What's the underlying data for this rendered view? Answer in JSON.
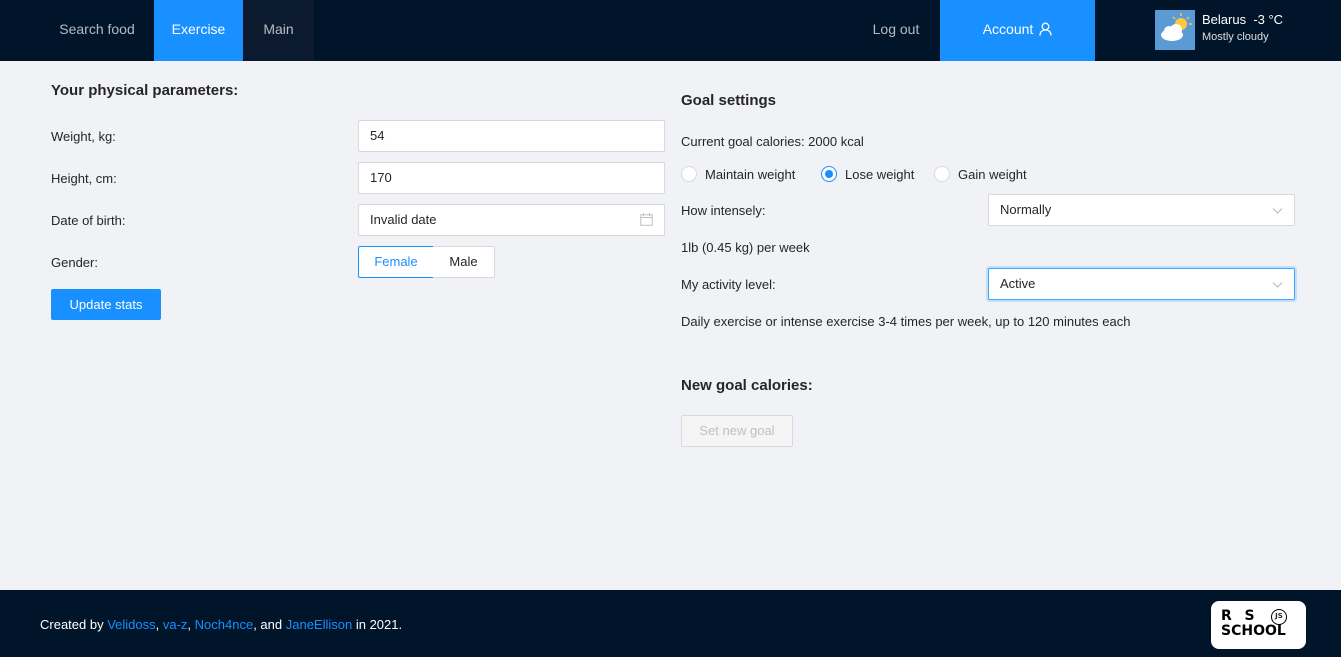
{
  "header": {
    "nav": {
      "search_food": "Search food",
      "exercise": "Exercise",
      "main": "Main",
      "logout": "Log out",
      "account": "Account"
    },
    "weather": {
      "location": "Belarus",
      "temperature": "-3 °C",
      "description": "Mostly cloudy",
      "icon": "partly-cloudy-icon"
    }
  },
  "physical": {
    "title": "Your physical parameters:",
    "weight_label": "Weight, kg:",
    "weight_value": "54",
    "height_label": "Height, cm:",
    "height_value": "170",
    "dob_label": "Date of birth:",
    "dob_value": "Invalid date",
    "gender_label": "Gender:",
    "gender_options": [
      "Female",
      "Male"
    ],
    "gender_selected": "Female",
    "update_button": "Update stats"
  },
  "goal": {
    "title": "Goal settings",
    "current_calories": "Current goal calories: 2000 kcal",
    "goal_options": [
      "Maintain weight",
      "Lose weight",
      "Gain weight"
    ],
    "goal_selected": "Lose weight",
    "intensity_label": "How intensely:",
    "intensity_value": "Normally",
    "intensity_note": "1lb (0.45 kg) per week",
    "activity_label": "My activity level:",
    "activity_value": "Active",
    "activity_note": "Daily exercise or intense exercise 3-4 times per week, up to 120 minutes each",
    "new_goal_title": "New goal calories:",
    "set_goal_button": "Set new goal"
  },
  "footer": {
    "prefix": "Created by ",
    "authors": [
      "Velidoss",
      "va-z",
      "Noch4nce",
      "JaneEllison"
    ],
    "sep1": ", ",
    "sep2": ", ",
    "sep3": ", and ",
    "suffix": " in 2021.",
    "logo_line1": "R  S",
    "logo_line2": "SCHOOL",
    "logo_badge": "JS"
  },
  "colors": {
    "header_bg": "#001529",
    "accent": "#1890ff",
    "page_bg": "#f0f2f5"
  }
}
